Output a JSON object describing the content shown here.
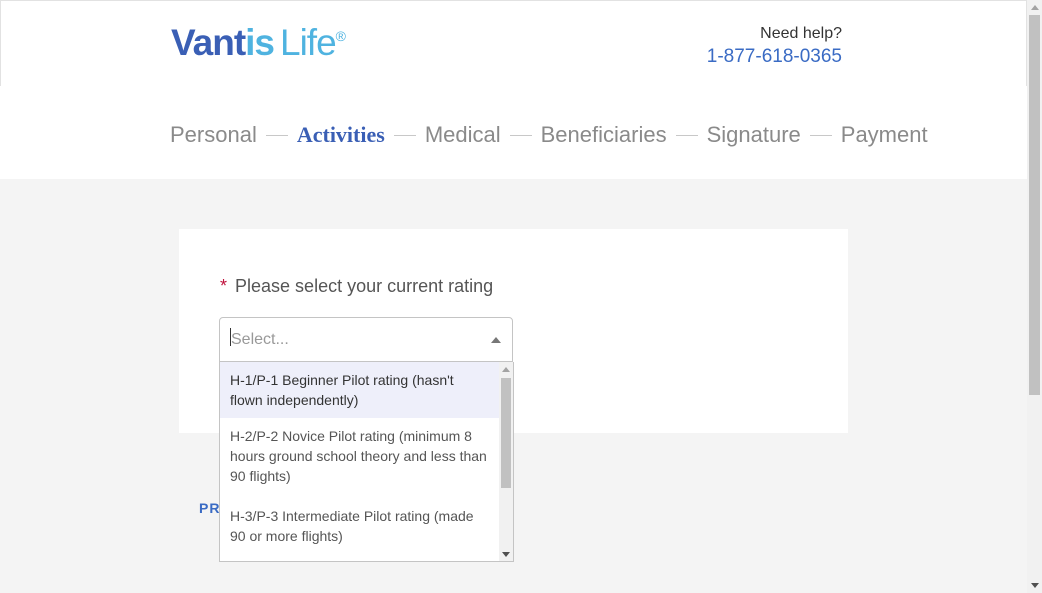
{
  "brand": {
    "name_part1": "Vant",
    "name_part2": "is",
    "name_part3": "Life",
    "registered": "®"
  },
  "help": {
    "label": "Need help?",
    "phone": "1-877-618-0365"
  },
  "steps": [
    {
      "label": "Personal"
    },
    {
      "label": "Activities"
    },
    {
      "label": "Medical"
    },
    {
      "label": "Beneficiaries"
    },
    {
      "label": "Signature"
    },
    {
      "label": "Payment"
    }
  ],
  "active_step": "Activities",
  "form": {
    "required_mark": "*",
    "question": "Please select your current rating",
    "select_placeholder": "Select...",
    "options": [
      "H-1/P-1 Beginner Pilot rating (hasn't flown independently)",
      "H-2/P-2 Novice Pilot rating (minimum 8 hours ground school theory and less than 90 flights)",
      "H-3/P-3 Intermediate Pilot rating (made 90 or more flights)"
    ]
  },
  "nav": {
    "previous_partial": "PR"
  },
  "colors": {
    "brand_blue": "#3a5fb5",
    "brand_light": "#4fb3e0",
    "required": "#c0123c",
    "link": "#3a6bc4"
  }
}
